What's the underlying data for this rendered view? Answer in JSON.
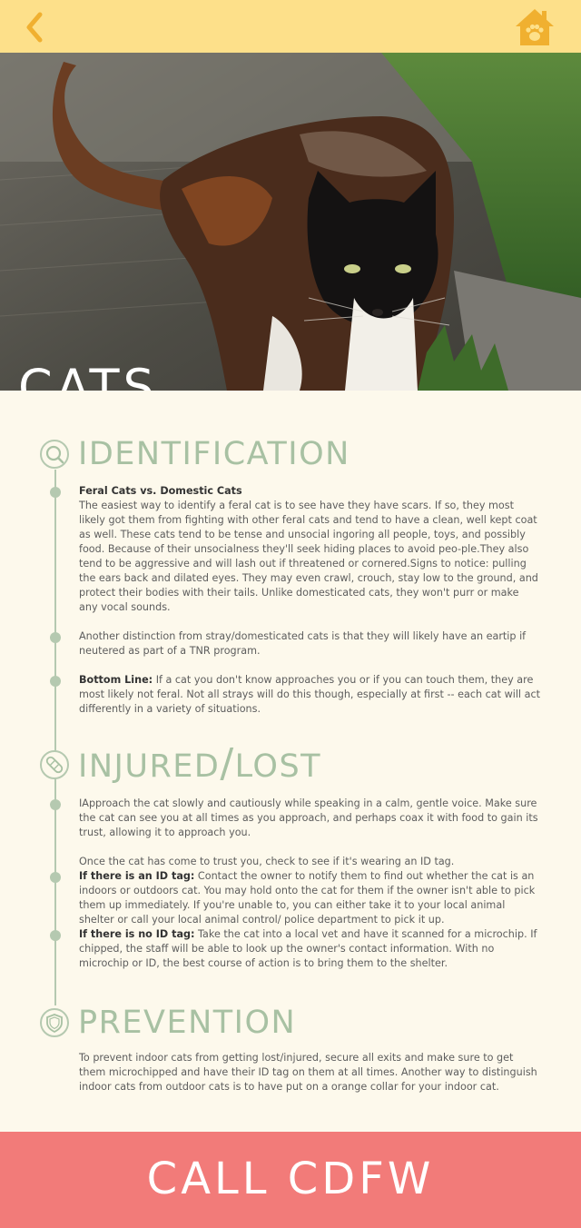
{
  "header": {
    "back_icon": "chevron-left-icon",
    "home_icon": "home-paw-icon",
    "accent_color": "#fde08a",
    "icon_color": "#f0b030"
  },
  "hero": {
    "title": "CATS",
    "image_description": "photo-cat"
  },
  "sections": [
    {
      "title": "IDENTIFICATION",
      "icon": "magnifier-icon",
      "items": [
        {
          "heading": "Feral Cats vs. Domestic Cats",
          "text": "The easiest way to identify a feral cat is to see have they have scars. If so, they most likely got them from fighting with other feral cats and tend to have a clean, well kept coat as well. These cats tend to be tense and unsocial ingoring all people, toys, and possibly food. Because of their unsocialness they'll seek hiding places to avoid peo-ple.They also tend to be aggressive and will lash out if threatened or cornered.Signs to notice: pulling the ears back and dilated eyes. They may even crawl, crouch, stay low to the ground, and protect their bodies with their tails. Unlike domesticated cats, they won't purr or make any vocal sounds."
        },
        {
          "text": "Another distinction from stray/domesticated cats is that they will likely have an eartip if neutered as part of a TNR program."
        },
        {
          "bold": "Bottom Line:",
          "text": " If a cat you don't know approaches you or if you can touch them, they are most likely not feral. Not all strays will do this though, especially at first -- each cat will act differently in a variety of situations."
        }
      ]
    },
    {
      "title_a": "INJURED",
      "title_sep": "/",
      "title_b": "LOST",
      "icon": "bandage-icon",
      "items": [
        {
          "text": "IApproach the cat slowly and cautiously while speaking in a calm, gentle voice. Make sure the cat can see you at all times as you approach, and perhaps coax it with food to gain its trust, allowing it to approach you."
        },
        {
          "text": "Once the cat has come to trust you, check to see if it's wearing an ID tag."
        },
        {
          "bold": "If there is an ID tag:",
          "text": " Contact the owner to notify them to find out whether the cat is an indoors or outdoors cat. You may hold onto the cat for them if the owner isn't able to pick them up immediately. If you're unable to, you can either take it to your local animal shelter or call your local animal control/ police department to pick it up."
        },
        {
          "bold": "If there is no ID tag:",
          "text": " Take the cat into a local vet and have it scanned for a microchip. If chipped, the staff will be able to look up the owner's contact information. With no microchip or ID, the best course of action is to bring them to the shelter."
        }
      ]
    },
    {
      "title": "PREVENTION",
      "icon": "shield-icon",
      "items": [
        {
          "text": "To prevent indoor cats from getting lost/injured, secure all exits and make sure to get them microchipped and have their ID tag on them at all times. Another way to distinguish indoor cats from outdoor cats is to have put on a orange collar for your indoor cat."
        }
      ]
    }
  ],
  "cta": {
    "label": "CALL CDFW",
    "color": "#f27b79"
  }
}
